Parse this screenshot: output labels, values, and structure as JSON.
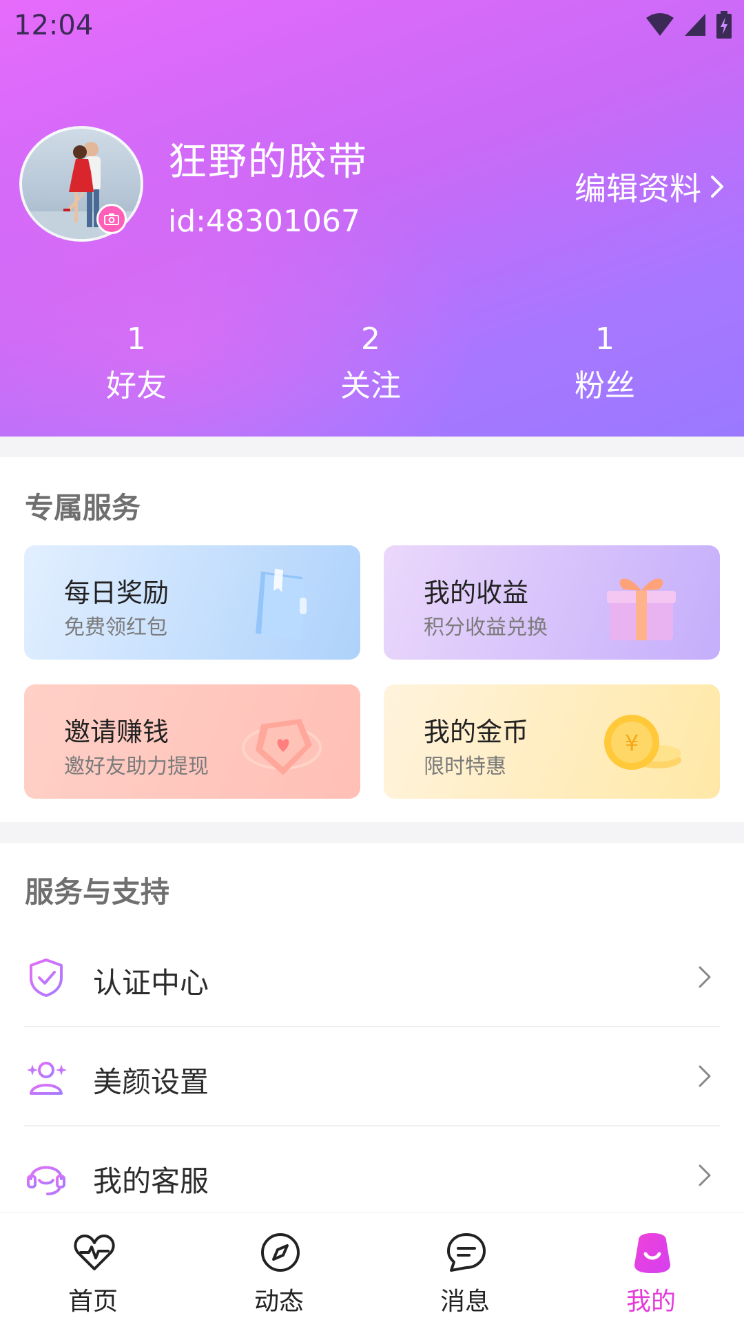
{
  "status_bar": {
    "time": "12:04"
  },
  "profile": {
    "username": "狂野的胶带",
    "user_id": "id:48301067",
    "edit_label": "编辑资料"
  },
  "stats": [
    {
      "value": "1",
      "label": "好友"
    },
    {
      "value": "2",
      "label": "关注"
    },
    {
      "value": "1",
      "label": "粉丝"
    }
  ],
  "exclusive_services": {
    "title": "专属服务",
    "cards": [
      {
        "title": "每日奖励",
        "subtitle": "免费领红包",
        "icon": "notebook-icon"
      },
      {
        "title": "我的收益",
        "subtitle": "积分收益兑换",
        "icon": "gift-box-icon"
      },
      {
        "title": "邀请赚钱",
        "subtitle": "邀好友助力提现",
        "icon": "heart-gem-icon"
      },
      {
        "title": "我的金币",
        "subtitle": "限时特惠",
        "icon": "gold-coin-icon"
      }
    ]
  },
  "support": {
    "title": "服务与支持",
    "items": [
      {
        "label": "认证中心",
        "icon": "shield-check-icon"
      },
      {
        "label": "美颜设置",
        "icon": "sparkle-person-icon"
      },
      {
        "label": "我的客服",
        "icon": "headset-icon"
      }
    ]
  },
  "tabbar": {
    "tabs": [
      {
        "label": "首页",
        "icon": "heart-pulse-icon"
      },
      {
        "label": "动态",
        "icon": "compass-icon"
      },
      {
        "label": "消息",
        "icon": "chat-bubble-icon"
      },
      {
        "label": "我的",
        "icon": "profile-face-icon"
      }
    ],
    "active_index": 3
  },
  "colors": {
    "header_gradient_start": "#e66bfb",
    "header_gradient_end": "#9a79ff",
    "active_tab": "#e53bd9",
    "menu_icon_accent": "#c86bf5"
  }
}
